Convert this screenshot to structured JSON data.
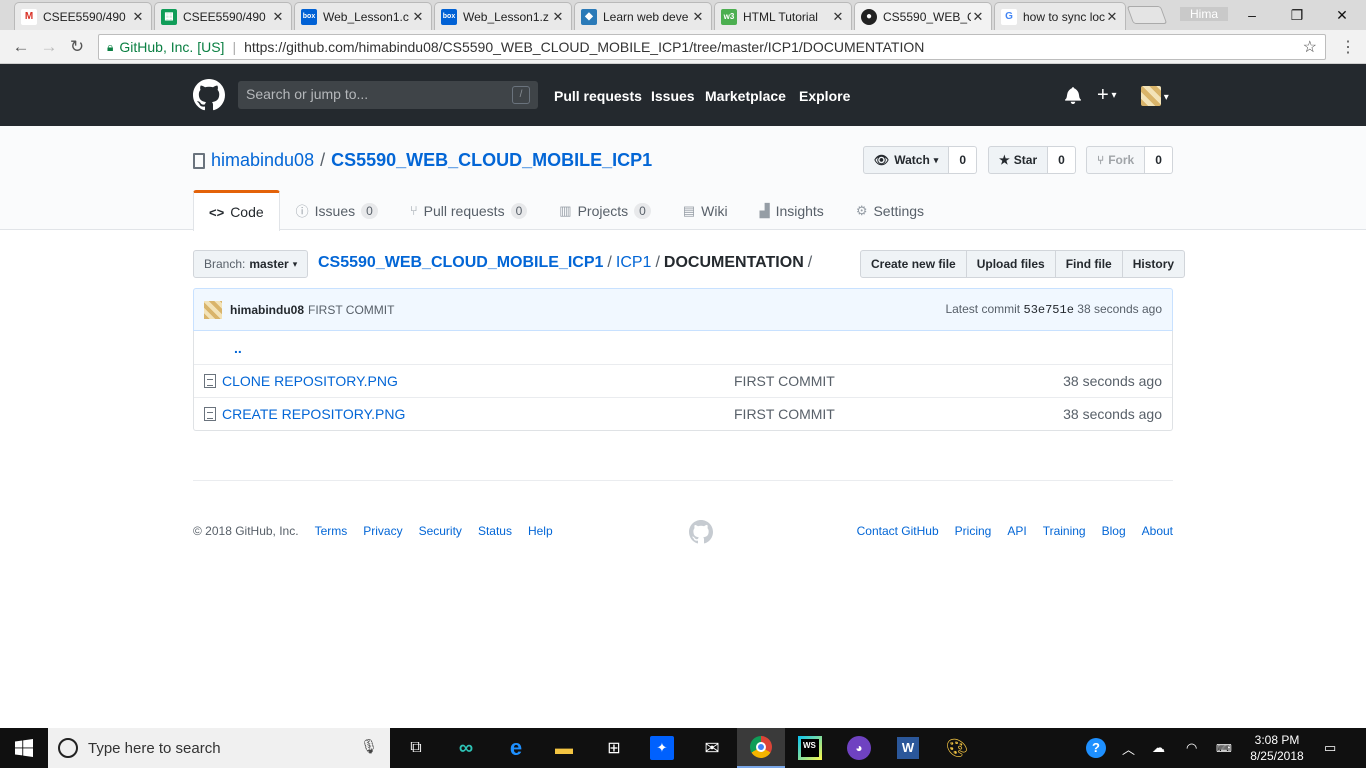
{
  "browser": {
    "tabs": [
      {
        "label": "CSEE5590/490",
        "icon": "gmail-icon"
      },
      {
        "label": "CSEE5590/490",
        "icon": "sheets-icon"
      },
      {
        "label": "Web_Lesson1.c",
        "icon": "box-icon"
      },
      {
        "label": "Web_Lesson1.z",
        "icon": "box-icon"
      },
      {
        "label": "Learn web deve",
        "icon": "web-icon"
      },
      {
        "label": "HTML Tutorial",
        "icon": "w3schools-icon"
      },
      {
        "label": "CS5590_WEB_C",
        "icon": "github-icon"
      },
      {
        "label": "how to sync loc",
        "icon": "google-icon"
      }
    ],
    "active_tab": 6,
    "user": "Hima",
    "secure_label": "GitHub, Inc. [US]",
    "url": "https://github.com/himabindu08/CS5590_WEB_CLOUD_MOBILE_ICP1/tree/master/ICP1/DOCUMENTATION"
  },
  "header": {
    "search_placeholder": "Search or jump to...",
    "search_shortcut": "/",
    "nav": [
      "Pull requests",
      "Issues",
      "Marketplace",
      "Explore"
    ]
  },
  "repo": {
    "owner": "himabindu08",
    "name": "CS5590_WEB_CLOUD_MOBILE_ICP1",
    "watch_label": "Watch",
    "watch_count": "0",
    "star_label": "Star",
    "star_count": "0",
    "fork_label": "Fork",
    "fork_count": "0",
    "tabs": [
      {
        "label": "Code",
        "icon": "code-icon",
        "counter": null
      },
      {
        "label": "Issues",
        "icon": "issue-icon",
        "counter": "0"
      },
      {
        "label": "Pull requests",
        "icon": "pull-request-icon",
        "counter": "0"
      },
      {
        "label": "Projects",
        "icon": "project-icon",
        "counter": "0"
      },
      {
        "label": "Wiki",
        "icon": "book-icon",
        "counter": null
      },
      {
        "label": "Insights",
        "icon": "graph-icon",
        "counter": null
      },
      {
        "label": "Settings",
        "icon": "gear-icon",
        "counter": null
      }
    ]
  },
  "filenav": {
    "branch_prefix": "Branch:",
    "branch": "master",
    "path": [
      "CS5590_WEB_CLOUD_MOBILE_ICP1",
      "ICP1"
    ],
    "current": "DOCUMENTATION",
    "actions": [
      "Create new file",
      "Upload files",
      "Find file",
      "History"
    ]
  },
  "commit": {
    "author": "himabindu08",
    "message": "FIRST COMMIT",
    "latest_prefix": "Latest commit",
    "sha": "53e751e",
    "age": "38 seconds ago"
  },
  "files": {
    "parent": "..",
    "rows": [
      {
        "name": "CLONE REPOSITORY.PNG",
        "message": "FIRST COMMIT",
        "age": "38 seconds ago"
      },
      {
        "name": "CREATE REPOSITORY.PNG",
        "message": "FIRST COMMIT",
        "age": "38 seconds ago"
      }
    ]
  },
  "footer": {
    "copyright": "© 2018 GitHub, Inc.",
    "left_links": [
      "Terms",
      "Privacy",
      "Security",
      "Status",
      "Help"
    ],
    "right_links": [
      "Contact GitHub",
      "Pricing",
      "API",
      "Training",
      "Blog",
      "About"
    ]
  },
  "taskbar": {
    "search_placeholder": "Type here to search",
    "time": "3:08 PM",
    "date": "8/25/2018"
  },
  "colors": {
    "accent": "#0366d6",
    "header_bg": "#24292e",
    "tab_underline": "#e36209"
  }
}
